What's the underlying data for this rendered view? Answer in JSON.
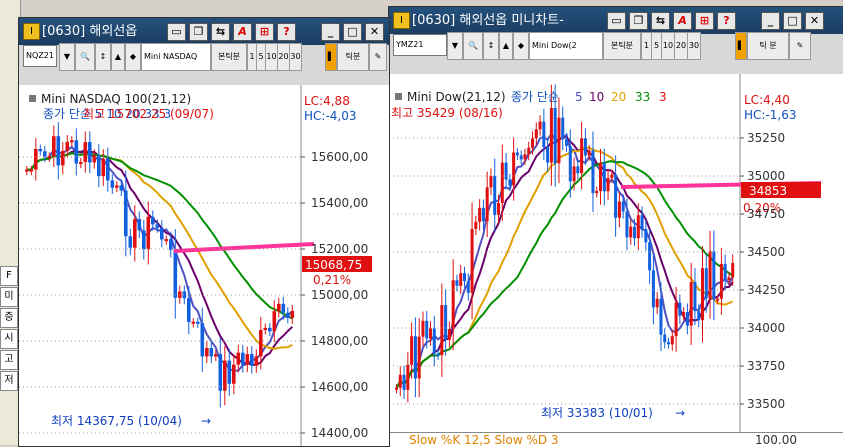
{
  "background": {
    "left_cells": [
      "F",
      "미",
      "증",
      "시",
      "고",
      "저"
    ]
  },
  "win1": {
    "title": "[0630] 해외선옵",
    "symbol": "NQZ21",
    "tool_label": "Mini NASDAQ",
    "periods": [
      "1",
      "5",
      "10",
      "20",
      "30"
    ],
    "legend": "Mini NASDAQ 100(21,12)",
    "legend2": "종가 단순 5 10 20 33 3",
    "high_label": "최고 15702.25 (09/07)",
    "lc": "LC:4,88",
    "hc": "HC:-4,03",
    "last_price": "15068,75",
    "last_change": "0,21%",
    "low_label": "최저 14367,75 (10/04)",
    "y_ticks": [
      "15600,00",
      "15400,00",
      "15200,00",
      "15000,00",
      "14800,00",
      "14600,00",
      "14400,00"
    ],
    "colors": {
      "up": "#e01010",
      "down": "#1060e0",
      "ma5": "#5050c0",
      "ma10": "#6a006a",
      "ma20": "#e0a000",
      "ma33": "#009000",
      "hline": "#ff3399"
    }
  },
  "win2": {
    "title": "[0630] 해외선옵 미니차트-",
    "symbol": "YMZ21",
    "tool_label": "Mini Dow(2",
    "periods": [
      "1",
      "5",
      "10",
      "20",
      "30"
    ],
    "legend": "Mini Dow(21,12)",
    "legend_ma": [
      "종가 단순",
      "5",
      "10",
      "20",
      "33",
      "3"
    ],
    "high_label": "최고 35429 (08/16)",
    "lc": "LC:4,40",
    "hc": "HC:-1,63",
    "last_price": "34853",
    "last_change": "0,20%",
    "low_label": "최저 33383 (10/01)",
    "y_ticks": [
      "35250",
      "35000",
      "34750",
      "34500",
      "34250",
      "34000",
      "33750",
      "33500"
    ],
    "bottom_label": "Slow %K 12,5  Slow %D 3",
    "bottom_tick": "100.00",
    "colors": {
      "up": "#e01010",
      "down": "#1060e0",
      "ma5": "#5050c0",
      "ma10": "#6a006a",
      "ma20": "#e0a000",
      "ma33": "#009000",
      "hline": "#ff3399"
    }
  }
}
